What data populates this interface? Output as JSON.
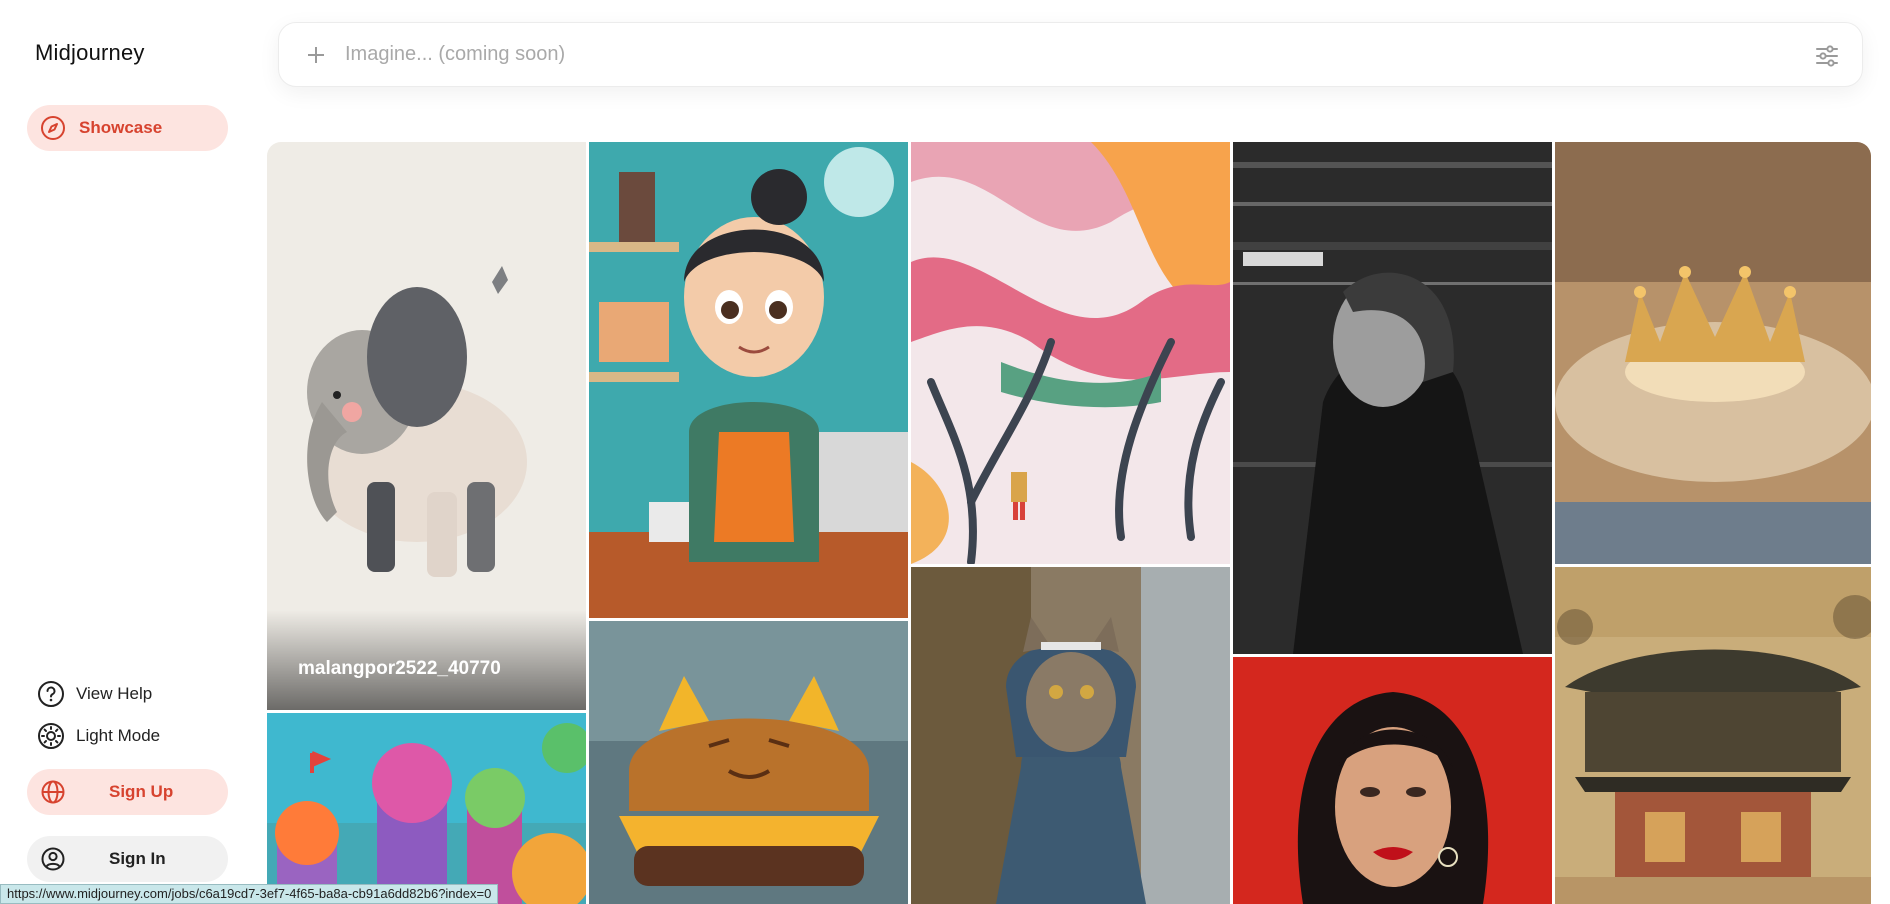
{
  "sidebar": {
    "brand": "Midjourney",
    "showcase": {
      "label": "Showcase",
      "icon": "compass-icon"
    },
    "help": {
      "label": "View Help",
      "icon": "question-circle-icon"
    },
    "light_mode": {
      "label": "Light Mode",
      "icon": "sun-icon"
    },
    "sign_up": {
      "label": "Sign Up",
      "icon": "globe-icon"
    },
    "sign_in": {
      "label": "Sign In",
      "icon": "user-circle-icon"
    }
  },
  "search": {
    "placeholder": "Imagine... (coming soon)",
    "value": "",
    "plus_icon": "plus-icon",
    "filter_icon": "sliders-icon"
  },
  "gallery": {
    "hover_caption": "malangpor2522_40770",
    "tiles": [
      "watercolor elephant",
      "cartoon girl barista",
      "flowing ribbon trees",
      "black and white woman portrait",
      "golden crown splash",
      "felt candy houses",
      "cat burger",
      "cat in blue hoodie",
      "woman red lips",
      "ancient palace painting"
    ]
  },
  "status_url": "https://www.midjourney.com/jobs/c6a19cd7-3ef7-4f65-ba8a-cb91a6dd82b6?index=0",
  "colors": {
    "accent": "#d7432f",
    "accent_bg": "#fde4e0"
  }
}
